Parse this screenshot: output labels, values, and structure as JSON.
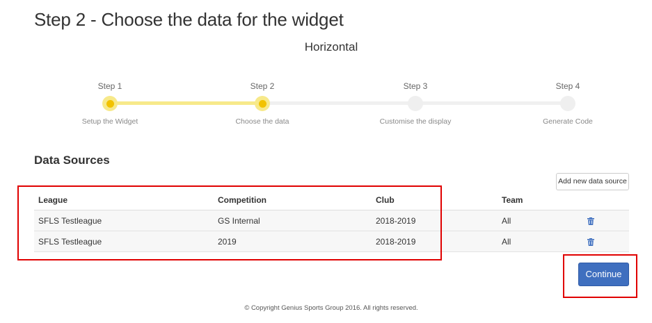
{
  "page": {
    "title": "Step 2 - Choose the data for the widget",
    "widget_type": "Horizontal"
  },
  "stepper": {
    "steps": [
      {
        "label": "Step 1",
        "caption": "Setup the Widget",
        "state": "completed"
      },
      {
        "label": "Step 2",
        "caption": "Choose the data",
        "state": "current"
      },
      {
        "label": "Step 3",
        "caption": "Customise the display",
        "state": "pending"
      },
      {
        "label": "Step 4",
        "caption": "Generate Code",
        "state": "pending"
      }
    ],
    "colors": {
      "progress": "#f7e98a",
      "dot": "#f2c200",
      "inactive": "#efefef"
    }
  },
  "data_sources": {
    "title": "Data Sources",
    "add_button": "Add new data source",
    "columns": [
      "League",
      "Competition",
      "Club",
      "Team"
    ],
    "rows": [
      {
        "league": "SFLS Testleague",
        "competition": "GS Internal",
        "club": "2018-2019",
        "team": "All",
        "action_icon": "trash-icon"
      },
      {
        "league": "SFLS Testleague",
        "competition": "2019",
        "club": "2018-2019",
        "team": "All",
        "action_icon": "trash-icon"
      }
    ]
  },
  "actions": {
    "continue_label": "Continue",
    "continue_color": "#3f6fbf",
    "highlight_color": "#e00000"
  },
  "footer": {
    "copyright": "© Copyright Genius Sports Group 2016. All rights reserved."
  }
}
